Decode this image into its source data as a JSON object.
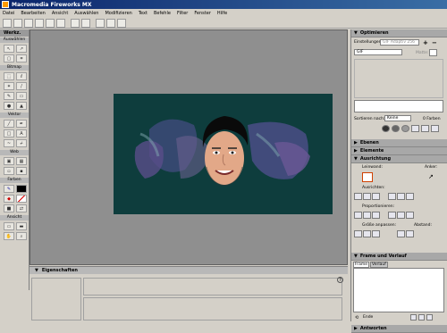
{
  "app": {
    "title": "Macromedia Fireworks MX"
  },
  "menu": [
    "Datei",
    "Bearbeiten",
    "Ansicht",
    "Auswählen",
    "Modifizieren",
    "Text",
    "Befehle",
    "Filter",
    "Fenster",
    "Hilfe"
  ],
  "tools": {
    "title": "Werkz.",
    "sections": {
      "select": "Auswählen",
      "bitmap": "Bitmap",
      "vector": "Vektor",
      "web": "Web",
      "colors": "Farben",
      "view": "Ansicht"
    }
  },
  "properties": {
    "title": "Eigenschaften"
  },
  "panel": {
    "optimize": {
      "title": "Optimieren",
      "settings_label": "Einstellungen:",
      "settings_value": "GIF Adaptiv 256",
      "format_value": "GIF",
      "matte_label": "Matte:",
      "sort_label": "Sortieren nach:",
      "sort_value": "Keine",
      "colors_count": "0 Farben"
    },
    "layers": {
      "title": "Ebenen"
    },
    "elements": {
      "title": "Elemente"
    },
    "align": {
      "title": "Ausrichtung",
      "canvas_label": "Leinwand:",
      "anchor_label": "Anker:",
      "align_label": "Ausrichten:",
      "distribute_label": "Proportionieren:",
      "match_size_label": "Größe anpassen:",
      "spacing_label": "Abstand:"
    },
    "frames": {
      "title": "Frame und Verlauf",
      "tabs": [
        "Frame",
        "Verlauf"
      ],
      "replay_label": "Ende"
    },
    "answers": {
      "title": "Antworten"
    }
  },
  "colors": {
    "accent": "#0a246a",
    "doc_bg": "#0e3d3d"
  }
}
